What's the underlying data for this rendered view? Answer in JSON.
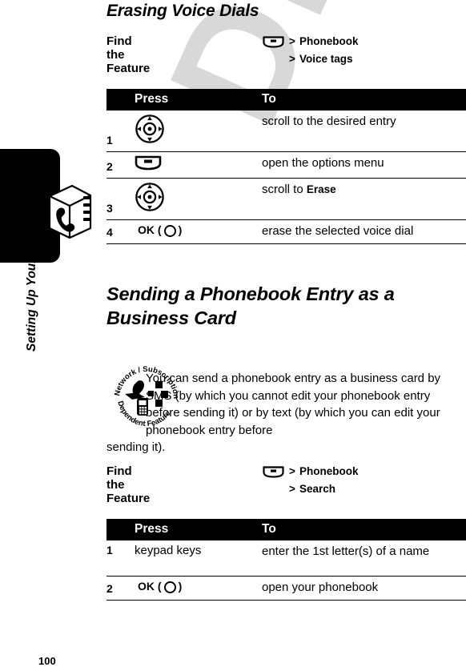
{
  "document": {
    "page_number": "100",
    "running_head": "Setting Up Your Phonebook",
    "watermark": "DRAFT"
  },
  "icons": {
    "phonebook_tab": "phonebook-book-icon",
    "menu_key": "menu-key-icon",
    "nav_key": "navigation-key-icon",
    "ok_key": "ok-key-icon",
    "network_subscription": "network-subscription-dependent-feature-icon",
    "network_subscription_text_top": "Network / Subscription",
    "network_subscription_text_bottom": "Dependent Feature"
  },
  "section1": {
    "heading": "Erasing Voice Dials",
    "find_the_feature": {
      "label": "Find the Feature",
      "steps": [
        "Phonebook",
        "Voice tags"
      ],
      "separator": ">"
    },
    "table": {
      "headers": {
        "num": "",
        "press": "Press",
        "to": "To"
      },
      "rows": [
        {
          "num": "1",
          "press_icon": "navigation-key-icon",
          "press_text": "",
          "to": "scroll to the desired entry",
          "to_bold": ""
        },
        {
          "num": "2",
          "press_icon": "menu-key-icon",
          "press_text": "",
          "to": "open the options menu",
          "to_bold": ""
        },
        {
          "num": "3",
          "press_icon": "navigation-key-icon",
          "press_text": "",
          "to": "scroll to ",
          "to_bold": "Erase"
        },
        {
          "num": "4",
          "press_icon": "ok-key-icon",
          "press_text": "OK",
          "to": "erase the selected voice dial",
          "to_bold": ""
        }
      ]
    }
  },
  "section2": {
    "heading": "Sending a Phonebook Entry as a Business Card",
    "body": "You can send a phonebook entry as a business card by SMS (by which you cannot edit your phonebook entry before sending it) or by text (by which you can edit your phonebook entry before",
    "body_tail": "sending it).",
    "find_the_feature": {
      "label": "Find the Feature",
      "steps": [
        "Phonebook",
        "Search"
      ],
      "separator": ">"
    },
    "table": {
      "headers": {
        "num": "",
        "press": "Press",
        "to": "To"
      },
      "rows": [
        {
          "num": "1",
          "press_icon": "",
          "press_text": "keypad keys",
          "to": "enter the 1st letter(s) of a name",
          "to_bold": ""
        },
        {
          "num": "2",
          "press_icon": "ok-key-icon",
          "press_text": "OK",
          "to": "open your phonebook",
          "to_bold": ""
        }
      ]
    }
  },
  "colors": {
    "ink": "#000000",
    "paper": "#ffffff",
    "watermark": "#d8d8d8",
    "header_band": "#000000",
    "header_text": "#ffffff"
  }
}
